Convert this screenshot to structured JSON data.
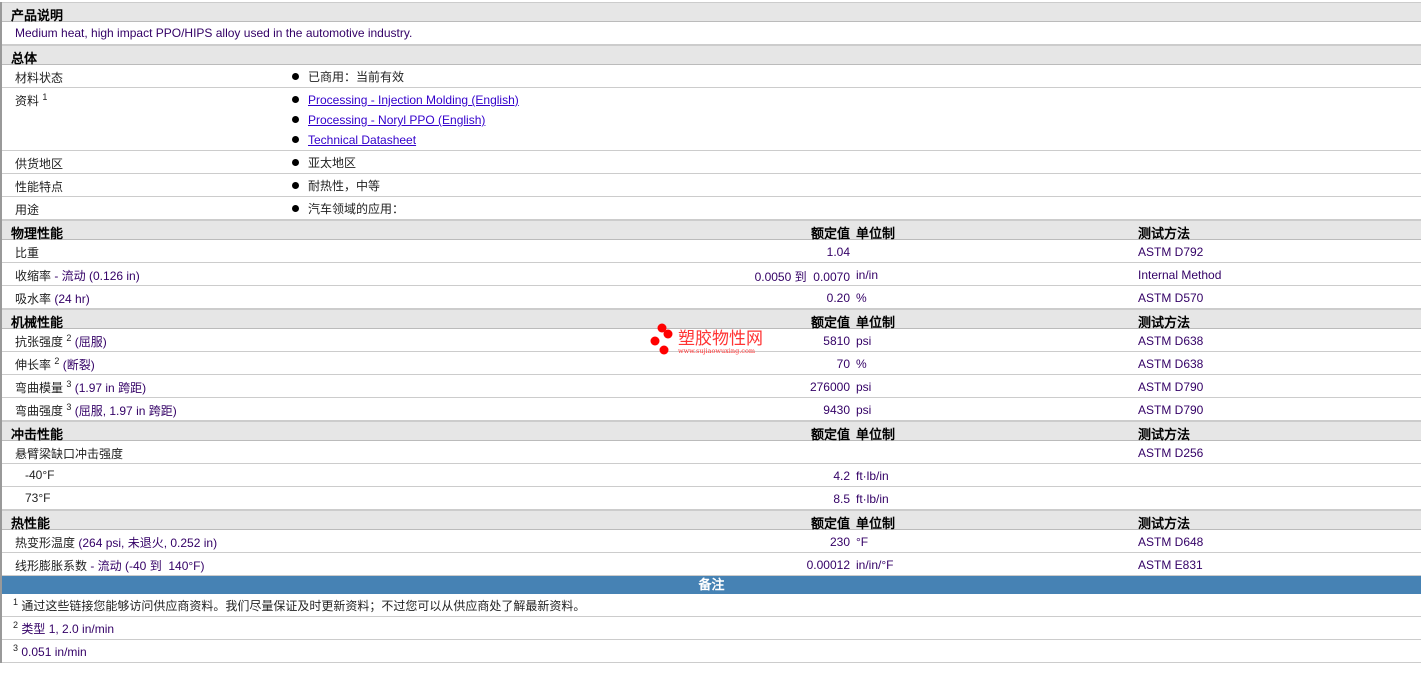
{
  "product": {
    "header": "产品说明",
    "description": "Medium heat, high impact PPO/HIPS alloy used in the automotive industry."
  },
  "general": {
    "header": "总体",
    "rows": [
      {
        "label": "材料状态",
        "values": [
          "已商用：当前有效"
        ]
      },
      {
        "label": "资料",
        "sup": "1",
        "links": [
          "Processing - Injection Molding (English)",
          "Processing - Noryl PPO (English)",
          "Technical Datasheet"
        ]
      },
      {
        "label": "供货地区",
        "values": [
          "亚太地区"
        ]
      },
      {
        "label": "性能特点",
        "values": [
          "耐热性，中等"
        ]
      },
      {
        "label": "用途",
        "values": [
          "汽车领域的应用："
        ]
      }
    ]
  },
  "columns": {
    "value": "额定值",
    "unit": "单位制",
    "method": "测试方法"
  },
  "sections": [
    {
      "header": "物理性能",
      "rows": [
        {
          "label": "比重",
          "value": "1.04",
          "unit": "",
          "method": "ASTM D792"
        },
        {
          "label": "收缩率",
          "sub": " - 流动 (0.126 in)",
          "value": "0.0050 到  0.0070",
          "unit": "in/in",
          "method": "Internal Method"
        },
        {
          "label": "吸水率",
          "sub": " (24 hr)",
          "value": "0.20",
          "unit": "%",
          "method": "ASTM D570"
        }
      ]
    },
    {
      "header": "机械性能",
      "rows": [
        {
          "label": "抗张强度",
          "sup": "2",
          "sub": " (屈服)",
          "value": "5810",
          "unit": "psi",
          "method": "ASTM D638"
        },
        {
          "label": "伸长率",
          "sup": "2",
          "sub": " (断裂)",
          "value": "70",
          "unit": "%",
          "method": "ASTM D638"
        },
        {
          "label": "弯曲模量",
          "sup": "3",
          "sub": " (1.97 in 跨距)",
          "value": "276000",
          "unit": "psi",
          "method": "ASTM D790"
        },
        {
          "label": "弯曲强度",
          "sup": "3",
          "sub": " (屈服, 1.97 in 跨距)",
          "value": "9430",
          "unit": "psi",
          "method": "ASTM D790"
        }
      ]
    },
    {
      "header": "冲击性能",
      "rows": [
        {
          "label": "悬臂梁缺口冲击强度",
          "value": "",
          "unit": "",
          "method": "ASTM D256"
        },
        {
          "label": "   -40°F",
          "value": "4.2",
          "unit": "ft·lb/in",
          "method": "",
          "indent": true
        },
        {
          "label": "   73°F",
          "value": "8.5",
          "unit": "ft·lb/in",
          "method": "",
          "indent": true
        }
      ]
    },
    {
      "header": "热性能",
      "rows": [
        {
          "label": "热变形温度",
          "sub": " (264 psi, 未退火, 0.252 in)",
          "value": "230",
          "unit": "°F",
          "method": "ASTM D648"
        },
        {
          "label": "线形膨胀系数",
          "sub": " - 流动 (-40 到  140°F)",
          "value": "0.00012",
          "unit": "in/in/°F",
          "method": "ASTM E831"
        }
      ]
    }
  ],
  "notes": {
    "header": "备注",
    "items": [
      {
        "num": "1",
        "text": "通过这些链接您能够访问供应商资料。我们尽量保证及时更新资料；不过您可以从供应商处了解最新资料。"
      },
      {
        "num": "2",
        "text": "类型  1, 2.0 in/min"
      },
      {
        "num": "3",
        "text": "0.051 in/min"
      }
    ]
  },
  "watermark": {
    "name": "塑胶物性网",
    "url": "www.sujiaowuxing.com"
  }
}
